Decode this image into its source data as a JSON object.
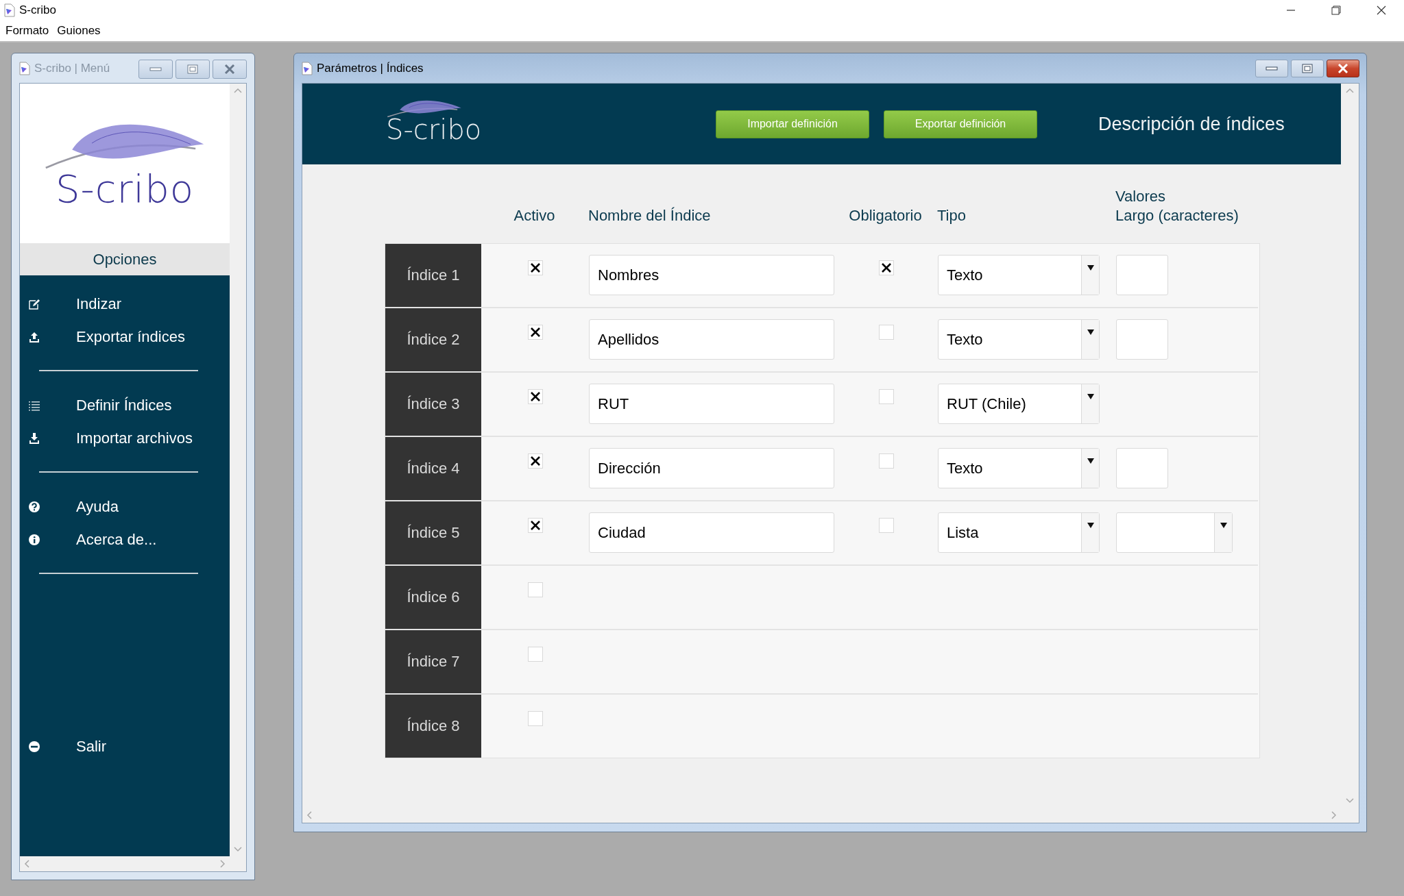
{
  "app": {
    "title": "S-cribo",
    "menu": [
      "Formato",
      "Guiones"
    ]
  },
  "menu_window": {
    "title": "S-cribo | Menú",
    "logo": "S-cribo",
    "section": "Opciones",
    "groups": [
      {
        "items": [
          "Indizar",
          "Exportar índices"
        ]
      },
      {
        "items": [
          "Definir Índices",
          "Importar archivos"
        ]
      },
      {
        "items": [
          "Ayuda",
          "Acerca de..."
        ]
      },
      {
        "items": [
          "Salir"
        ]
      }
    ]
  },
  "params_window": {
    "title": "Parámetros | Índices",
    "logo": "S-cribo",
    "buttons": [
      "Importar definición",
      "Exportar definición"
    ],
    "heading": "Descripción de índices",
    "columns": [
      "Activo",
      "Nombre del Índice",
      "Obligatorio",
      "Tipo",
      "Valores\nLargo (caracteres)"
    ],
    "rows": [
      {
        "label": "Índice 1",
        "active": true,
        "name": "Nombres",
        "required": true,
        "type": "Texto",
        "values": {
          "kind": "field"
        }
      },
      {
        "label": "Índice 2",
        "active": true,
        "name": "Apellidos",
        "required": false,
        "type": "Texto",
        "values": {
          "kind": "field"
        }
      },
      {
        "label": "Índice 3",
        "active": true,
        "name": "RUT",
        "required": false,
        "type": "RUT (Chile)"
      },
      {
        "label": "Índice 4",
        "active": true,
        "name": "Dirección",
        "required": false,
        "type": "Texto",
        "values": {
          "kind": "field"
        }
      },
      {
        "label": "Índice 5",
        "active": true,
        "name": "Ciudad",
        "required": false,
        "type": "Lista",
        "values": {
          "kind": "select"
        }
      },
      {
        "label": "Índice 6",
        "active": false
      },
      {
        "label": "Índice 7",
        "active": false
      },
      {
        "label": "Índice 8",
        "active": false
      }
    ]
  }
}
